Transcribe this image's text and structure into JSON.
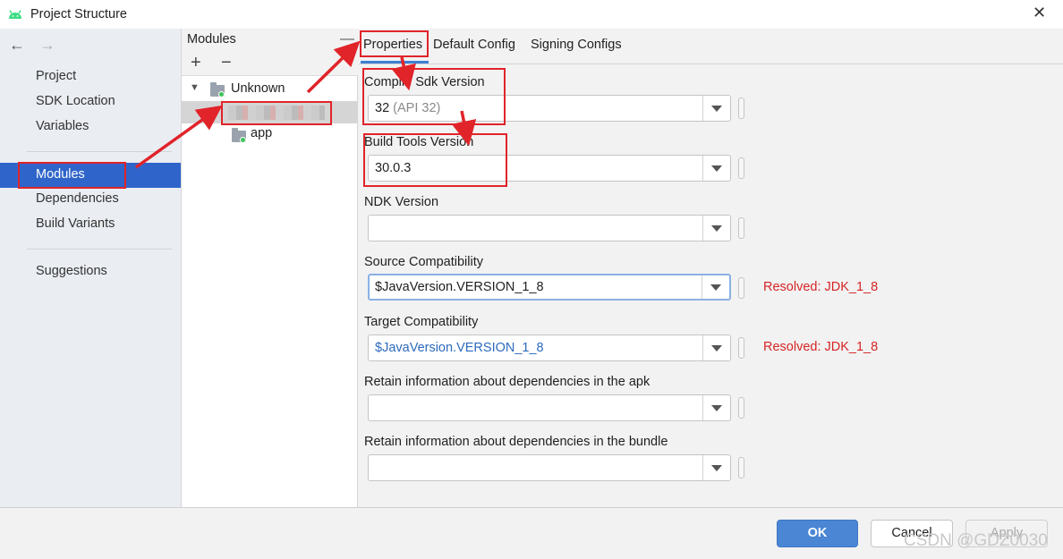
{
  "window": {
    "title": "Project Structure",
    "close_glyph": "✕"
  },
  "nav": {
    "back_glyph": "←",
    "forward_glyph": "→"
  },
  "sidebar": {
    "items": [
      {
        "label": "Project"
      },
      {
        "label": "SDK Location"
      },
      {
        "label": "Variables"
      },
      {
        "label": "Modules",
        "selected": true
      },
      {
        "label": "Dependencies"
      },
      {
        "label": "Build Variants"
      },
      {
        "label": "Suggestions"
      }
    ]
  },
  "modules_panel": {
    "title": "Modules",
    "minimize_glyph": "—",
    "add_glyph": "+",
    "remove_glyph": "−",
    "tree": [
      {
        "label": "Unknown",
        "expanded": true
      },
      {
        "label": "",
        "redacted": true
      },
      {
        "label": "app"
      }
    ]
  },
  "tabs": [
    {
      "label": "Properties",
      "active": true
    },
    {
      "label": "Default Config"
    },
    {
      "label": "Signing Configs"
    }
  ],
  "fields": [
    {
      "label": "Compile Sdk Version",
      "value": "32",
      "hint": "(API 32)"
    },
    {
      "label": "Build Tools Version",
      "value": "30.0.3"
    },
    {
      "label": "NDK Version",
      "value": ""
    },
    {
      "label": "Source Compatibility",
      "value": "$JavaVersion.VERSION_1_8",
      "resolved": "Resolved: JDK_1_8",
      "focused": true
    },
    {
      "label": "Target Compatibility",
      "value": "$JavaVersion.VERSION_1_8",
      "resolved": "Resolved: JDK_1_8",
      "value_color": "#2d6bbd"
    },
    {
      "label": "Retain information about dependencies in the apk",
      "value": ""
    },
    {
      "label": "Retain information about dependencies in the bundle",
      "value": ""
    }
  ],
  "footer": {
    "ok_label": "OK",
    "cancel_label": "Cancel",
    "apply_label": "Apply",
    "watermark": "CSDN @GDZ0030"
  },
  "colors": {
    "accent": "#2f65ca",
    "ok_button": "#4a86d4",
    "resolved_text": "#d62525",
    "annotation": "#e0242a",
    "android_green": "#3ddc84"
  },
  "icons": {
    "app_logo": "android-icon",
    "folder": "module-folder-icon",
    "dropdown": "chevron-down-icon"
  }
}
